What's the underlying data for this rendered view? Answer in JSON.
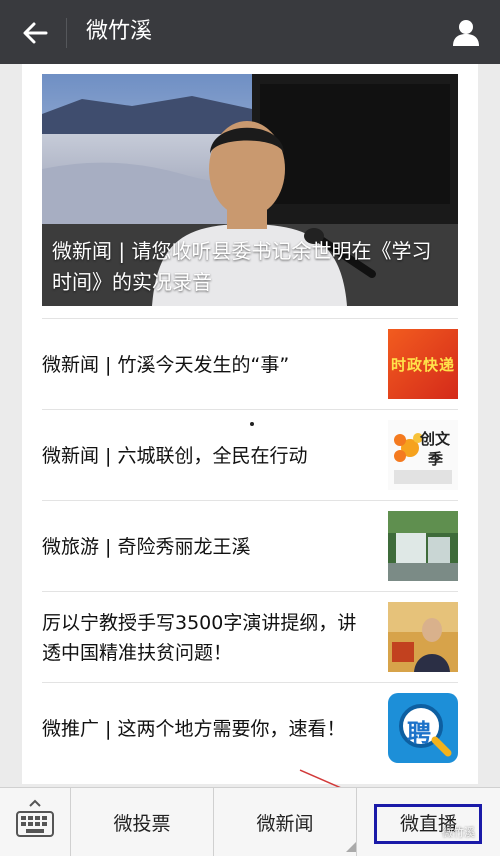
{
  "header": {
    "title": "微竹溪"
  },
  "hero": {
    "caption": "微新闻 | 请您收听县委书记余世明在《学习时间》的实况录音"
  },
  "items": [
    {
      "title": "微新闻 | 竹溪今天发生的“事”",
      "thumb_text": "时政快递"
    },
    {
      "title": "微新闻 | 六城联创，全民在行动",
      "thumb_text_1": "创文",
      "thumb_text_2": "季"
    },
    {
      "title": "微旅游 | 奇险秀丽龙王溪"
    },
    {
      "title": "厉以宁教授手写3500字演讲提纲，讲透中国精准扶贫问题！"
    },
    {
      "title": "微推广 | 这两个地方需要你，速看！",
      "thumb_text": "聘"
    }
  ],
  "menu": {
    "item1": "微投票",
    "item2": "微新闻",
    "item3": "微直播"
  },
  "watermark": "微竹溪",
  "colors": {
    "topbar": "#393a3e",
    "highlight": "#1a1aa8"
  }
}
